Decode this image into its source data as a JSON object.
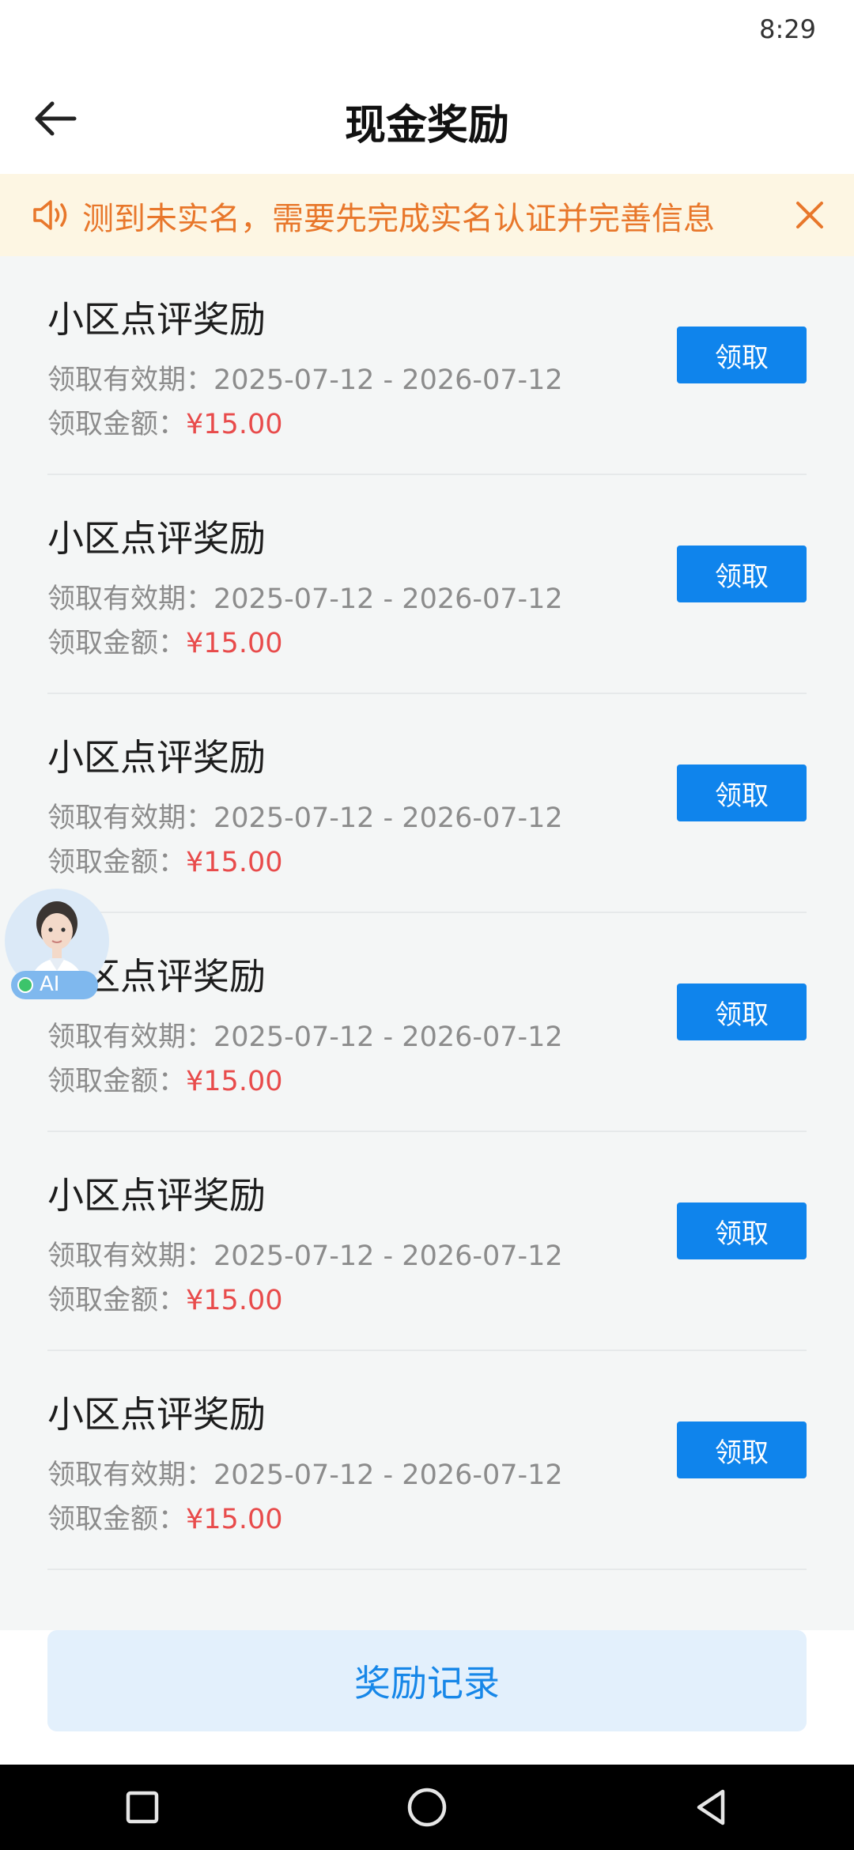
{
  "status_bar": {
    "time": "8:29"
  },
  "header": {
    "title": "现金奖励",
    "back_icon": "arrow-left-icon"
  },
  "notice": {
    "text": "测到未实名，需要先完成实名认证并完善信息",
    "icon": "speaker-icon",
    "close_icon": "close-icon",
    "color": "#e8772b",
    "background": "#fdf6e3"
  },
  "rewards": [
    {
      "title": "小区点评奖励",
      "period_label": "领取有效期：",
      "period": "2025-07-12 - 2026-07-12",
      "amount_label": "领取金额：",
      "amount": "¥15.00",
      "button": "领取"
    },
    {
      "title": "小区点评奖励",
      "period_label": "领取有效期：",
      "period": "2025-07-12 - 2026-07-12",
      "amount_label": "领取金额：",
      "amount": "¥15.00",
      "button": "领取"
    },
    {
      "title": "小区点评奖励",
      "period_label": "领取有效期：",
      "period": "2025-07-12 - 2026-07-12",
      "amount_label": "领取金额：",
      "amount": "¥15.00",
      "button": "领取"
    },
    {
      "title": "小区点评奖励",
      "period_label": "领取有效期：",
      "period": "2025-07-12 - 2026-07-12",
      "amount_label": "领取金额：",
      "amount": "¥15.00",
      "button": "领取"
    },
    {
      "title": "小区点评奖励",
      "period_label": "领取有效期：",
      "period": "2025-07-12 - 2026-07-12",
      "amount_label": "领取金额：",
      "amount": "¥15.00",
      "button": "领取"
    },
    {
      "title": "小区点评奖励",
      "period_label": "领取有效期：",
      "period": "2025-07-12 - 2026-07-12",
      "amount_label": "领取金额：",
      "amount": "¥15.00",
      "button": "领取"
    }
  ],
  "ai_assistant": {
    "label": "AI",
    "icon": "ai-avatar-icon"
  },
  "footer": {
    "records_button": "奖励记录"
  },
  "colors": {
    "primary": "#0f84ec",
    "amount": "#e84b4b",
    "records_bg": "#e3f0fc"
  },
  "system_nav": {
    "icons": [
      "recent-apps-icon",
      "home-icon",
      "back-triangle-icon"
    ]
  }
}
